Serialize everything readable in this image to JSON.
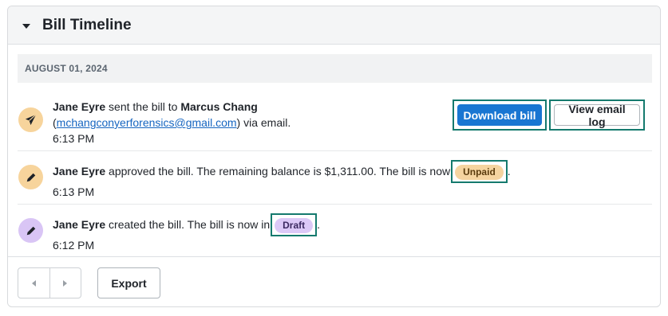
{
  "panel": {
    "title": "Bill Timeline"
  },
  "date_header": "AUGUST 01, 2024",
  "events": [
    {
      "actor": "Jane Eyre",
      "text_1": " sent the bill to ",
      "recipient": "Marcus Chang",
      "paren_open": "(",
      "email": "mchangconyerforensics@gmail.com",
      "text_2": ") via email.",
      "time": "6:13 PM",
      "icon": "paper-plane-icon",
      "actions": {
        "download": "Download bill",
        "email_log": "View email log"
      }
    },
    {
      "actor": "Jane Eyre",
      "text": " approved the bill. The remaining balance is $1,311.00. The bill is now",
      "badge": "Unpaid",
      "after": ".",
      "time": "6:13 PM",
      "icon": "pencil-icon"
    },
    {
      "actor": "Jane Eyre",
      "text": " created the bill. The bill is now in",
      "badge": "Draft",
      "after": ".",
      "time": "6:12 PM",
      "icon": "pencil-icon"
    }
  ],
  "footer": {
    "export_label": "Export"
  },
  "colors": {
    "primary": "#1976d2",
    "highlight": "#157a6e",
    "unpaid": "#f5d4a0",
    "draft": "#dcc9f7"
  }
}
